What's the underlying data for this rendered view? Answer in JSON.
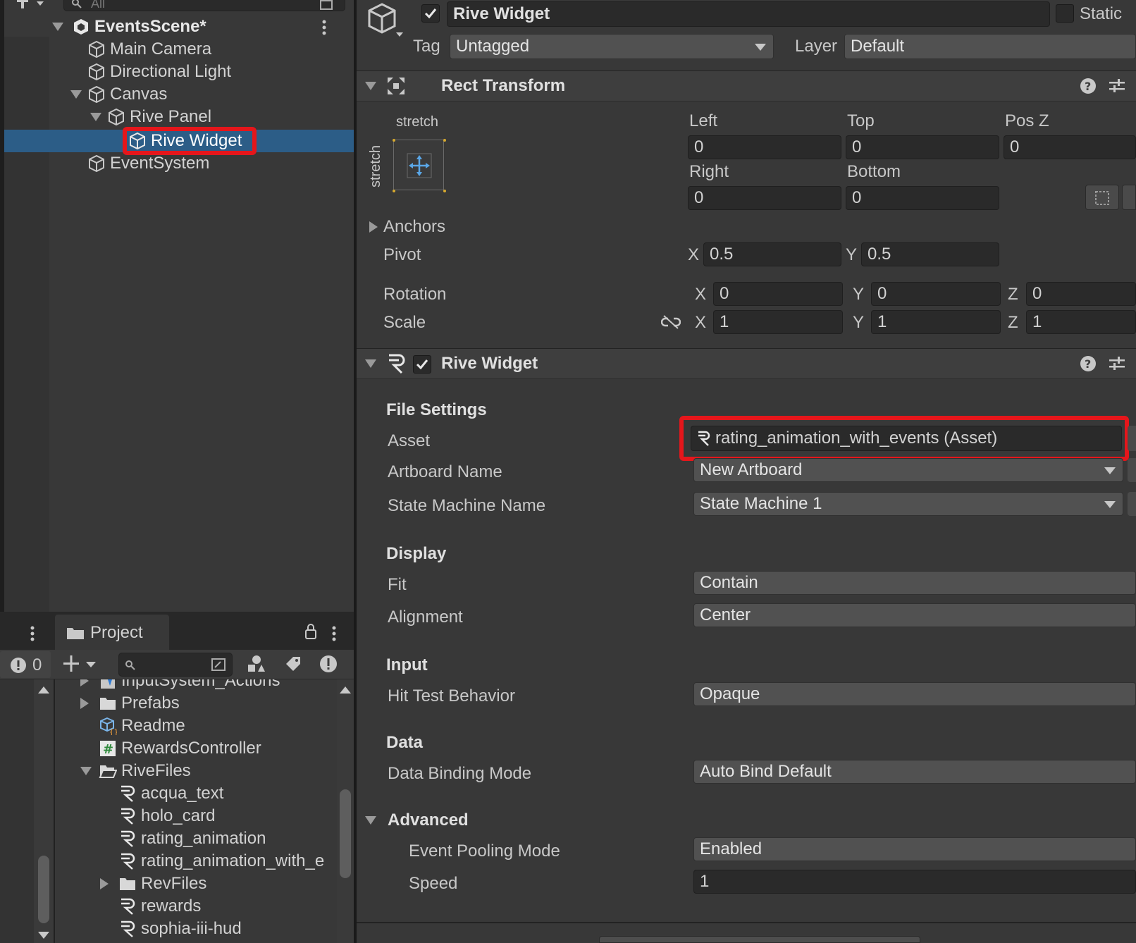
{
  "hierarchy": {
    "search_placeholder": "All",
    "scene_name": "EventsScene*",
    "items": [
      {
        "label": "Main Camera"
      },
      {
        "label": "Directional Light"
      },
      {
        "label": "Canvas"
      },
      {
        "label": "Rive Panel"
      },
      {
        "label": "Rive Widget"
      },
      {
        "label": "EventSystem"
      }
    ]
  },
  "project": {
    "tab_label": "Project",
    "console_count": "0",
    "items": [
      {
        "label": "InputSystem_Actions",
        "type": "asset"
      },
      {
        "label": "Prefabs",
        "type": "folder"
      },
      {
        "label": "Readme",
        "type": "readme"
      },
      {
        "label": "RewardsController",
        "type": "script"
      },
      {
        "label": "RiveFiles",
        "type": "folder-open"
      },
      {
        "label": "acqua_text",
        "type": "rive"
      },
      {
        "label": "holo_card",
        "type": "rive"
      },
      {
        "label": "rating_animation",
        "type": "rive"
      },
      {
        "label": "rating_animation_with_e",
        "type": "rive"
      },
      {
        "label": "RevFiles",
        "type": "folder"
      },
      {
        "label": "rewards",
        "type": "rive"
      },
      {
        "label": "sophia-iii-hud",
        "type": "rive"
      }
    ]
  },
  "inspector": {
    "object_name": "Rive Widget",
    "static_label": "Static",
    "tag_label": "Tag",
    "tag_value": "Untagged",
    "layer_label": "Layer",
    "layer_value": "Default",
    "rect_transform": {
      "title": "Rect Transform",
      "anchor_preset_h": "stretch",
      "anchor_preset_v": "stretch",
      "left_label": "Left",
      "left_value": "0",
      "top_label": "Top",
      "top_value": "0",
      "posz_label": "Pos Z",
      "posz_value": "0",
      "right_label": "Right",
      "right_value": "0",
      "bottom_label": "Bottom",
      "bottom_value": "0",
      "anchors_label": "Anchors",
      "pivot_label": "Pivot",
      "pivot_x": "0.5",
      "pivot_y": "0.5",
      "rotation_label": "Rotation",
      "rot_x": "0",
      "rot_y": "0",
      "rot_z": "0",
      "scale_label": "Scale",
      "scale_x": "1",
      "scale_y": "1",
      "scale_z": "1",
      "x_label": "X",
      "y_label": "Y",
      "z_label": "Z"
    },
    "rive_widget": {
      "title": "Rive Widget",
      "file_settings": "File Settings",
      "asset_label": "Asset",
      "asset_value": "rating_animation_with_events (Asset)",
      "artboard_label": "Artboard Name",
      "artboard_value": "New Artboard",
      "state_machine_label": "State Machine Name",
      "state_machine_value": "State Machine 1",
      "display": "Display",
      "fit_label": "Fit",
      "fit_value": "Contain",
      "alignment_label": "Alignment",
      "alignment_value": "Center",
      "input": "Input",
      "hit_test_label": "Hit Test Behavior",
      "hit_test_value": "Opaque",
      "data": "Data",
      "data_binding_label": "Data Binding Mode",
      "data_binding_value": "Auto Bind Default",
      "advanced": "Advanced",
      "event_pooling_label": "Event Pooling Mode",
      "event_pooling_value": "Enabled",
      "speed_label": "Speed",
      "speed_value": "1"
    }
  },
  "colors": {
    "selection": "#2c5d87",
    "highlight": "#e5161b",
    "panel": "#383838"
  }
}
